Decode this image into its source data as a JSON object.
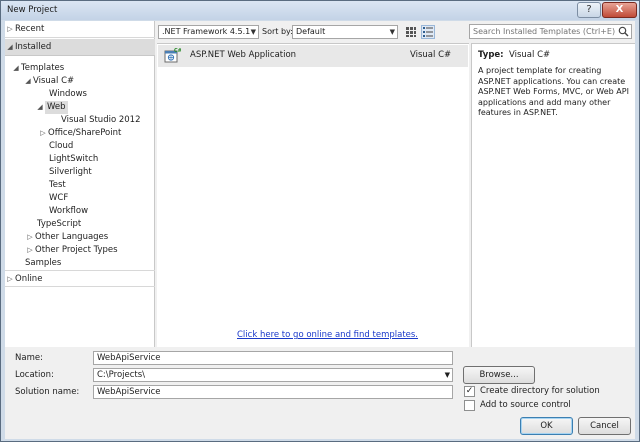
{
  "window": {
    "title": "New Project",
    "help_label": "?",
    "close_label": "X"
  },
  "nav": {
    "recent": "Recent",
    "installed": "Installed",
    "templates": "Templates",
    "visual_csharp": "Visual C#",
    "windows": "Windows",
    "web": "Web",
    "vs2012": "Visual Studio 2012",
    "office": "Office/SharePoint",
    "cloud": "Cloud",
    "lightswitch": "LightSwitch",
    "silverlight": "Silverlight",
    "test": "Test",
    "wcf": "WCF",
    "workflow": "Workflow",
    "typescript": "TypeScript",
    "other_languages": "Other Languages",
    "other_project_types": "Other Project Types",
    "samples": "Samples",
    "online": "Online"
  },
  "toolbar": {
    "framework": ".NET Framework 4.5.1",
    "sort_label": "Sort by:",
    "sort_value": "Default"
  },
  "search": {
    "placeholder": "Search Installed Templates (Ctrl+E)"
  },
  "templates": [
    {
      "name": "ASP.NET Web Application",
      "language": "Visual C#"
    }
  ],
  "online_link": "Click here to go online and find templates.",
  "details": {
    "type_label": "Type:",
    "type_value": "Visual C#",
    "description": "A project template for creating ASP.NET applications. You can create ASP.NET Web Forms, MVC,  or Web API applications and add many other features in ASP.NET."
  },
  "form": {
    "name_label": "Name:",
    "name_value": "WebApiService",
    "location_label": "Location:",
    "location_value": "C:\\Projects\\",
    "solution_label": "Solution name:",
    "solution_value": "WebApiService",
    "browse_label": "Browse...",
    "create_dir_label": "Create directory for solution",
    "create_dir_checked": true,
    "source_control_label": "Add to source control",
    "source_control_checked": false,
    "ok_label": "OK",
    "cancel_label": "Cancel"
  }
}
